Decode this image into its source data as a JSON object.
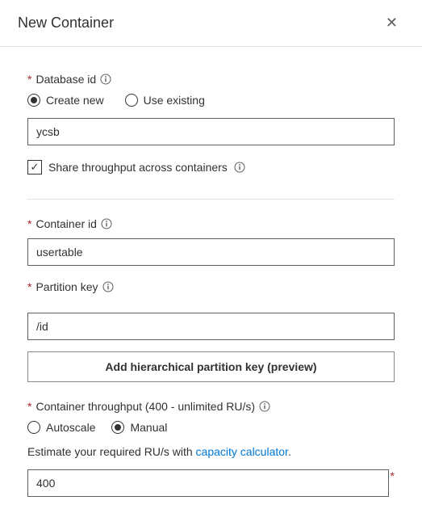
{
  "header": {
    "title": "New Container"
  },
  "database": {
    "label": "Database id",
    "radio_create": "Create new",
    "radio_existing": "Use existing",
    "selected": "create",
    "value": "ycsb",
    "share_label": "Share throughput across containers",
    "share_checked": true
  },
  "container": {
    "label": "Container id",
    "value": "usertable"
  },
  "partition": {
    "label": "Partition key",
    "value": "/id",
    "add_button": "Add hierarchical partition key (preview)"
  },
  "throughput": {
    "label": "Container throughput (400 - unlimited RU/s)",
    "radio_autoscale": "Autoscale",
    "radio_manual": "Manual",
    "selected": "manual",
    "estimate_prefix": "Estimate your required RU/s with ",
    "estimate_link": "capacity calculator",
    "estimate_suffix": ".",
    "value": "400"
  }
}
